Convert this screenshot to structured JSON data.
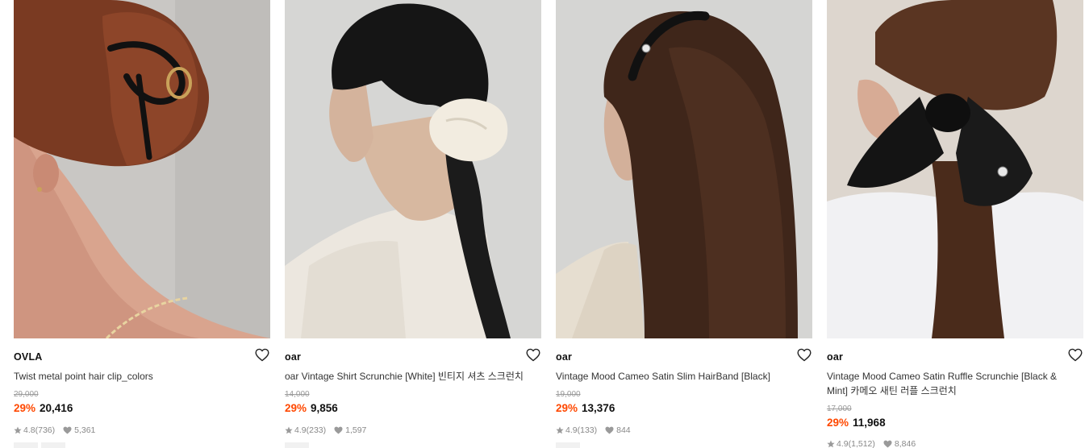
{
  "products": [
    {
      "brand": "OVLA",
      "title": "Twist metal point hair clip_colors",
      "original_price": "29,000",
      "discount": "29%",
      "price": "20,416",
      "rating": "4.8",
      "review_count": "(736)",
      "likes": "5,361"
    },
    {
      "brand": "oar",
      "title": "oar Vintage Shirt Scrunchie [White] 빈티지 셔츠 스크런치",
      "original_price": "14,000",
      "discount": "29%",
      "price": "9,856",
      "rating": "4.9",
      "review_count": "(233)",
      "likes": "1,597"
    },
    {
      "brand": "oar",
      "title": "Vintage Mood Cameo Satin Slim HairBand [Black]",
      "original_price": "19,000",
      "discount": "29%",
      "price": "13,376",
      "rating": "4.9",
      "review_count": "(133)",
      "likes": "844"
    },
    {
      "brand": "oar",
      "title": "Vintage Mood Cameo Satin Ruffle Scrunchie [Black & Mint] 카메오 새틴 러플 스크런치",
      "original_price": "17,000",
      "discount": "29%",
      "price": "11,968",
      "rating": "4.9",
      "review_count": "(1,512)",
      "likes": "8,846"
    }
  ],
  "colors": {
    "discount": "#ff4800",
    "price": "#111111",
    "muted": "#888888"
  }
}
